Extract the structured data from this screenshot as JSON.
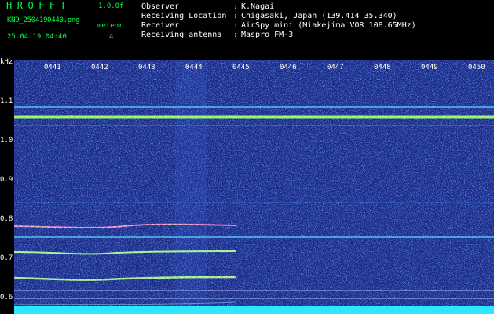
{
  "header": {
    "app_title": "HROFFT",
    "version": "1.0.0f",
    "filename": "KN9_2504190440.png",
    "datetime": "25.04.19 04:40",
    "meteor_label": "meteor",
    "meteor_count": "4",
    "info": [
      {
        "label": "Observer",
        "sep": ":",
        "value": "K.Nagai"
      },
      {
        "label": "Receiving Location",
        "sep": ":",
        "value": "Chigasaki, Japan (139.414 35.340)"
      },
      {
        "label": "Receiver",
        "sep": ":",
        "value": "AirSpy mini (Miakejima VOR 108.65MHz)"
      },
      {
        "label": "Receiving antenna",
        "sep": ":",
        "value": "Maspro FM-3"
      }
    ]
  },
  "spectrogram": {
    "y_unit": "kHz",
    "y_ticks": [
      "1.1",
      "1.0",
      "0.9",
      "0.8",
      "0.7",
      "0.6"
    ],
    "x_ticks": [
      "0441",
      "0442",
      "0443",
      "0444",
      "0445",
      "0446",
      "0447",
      "0448",
      "0449",
      "0450"
    ],
    "colors": {
      "background": "#1b2a86",
      "carrier": "#9cff6e",
      "bottom_band": "#2ee6ff"
    }
  }
}
